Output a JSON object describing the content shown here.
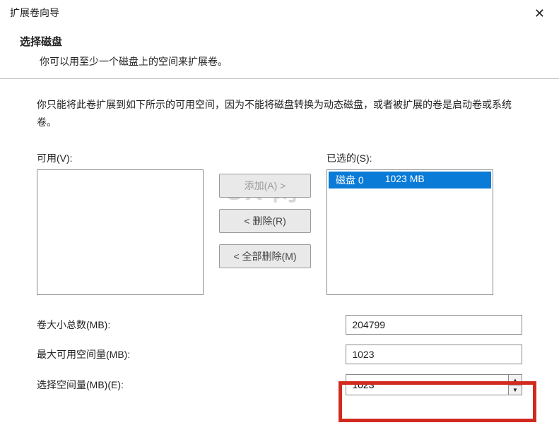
{
  "window": {
    "title": "扩展卷向导",
    "close_glyph": "✕"
  },
  "header": {
    "title": "选择磁盘",
    "subtitle": "你可以用至少一个磁盘上的空间来扩展卷。"
  },
  "description": "你只能将此卷扩展到如下所示的可用空间，因为不能将磁盘转换为动态磁盘，或者被扩展的卷是启动卷或系统卷。",
  "lists": {
    "available_label": "可用(V):",
    "selected_label": "已选的(S):",
    "available_items": [],
    "selected_items": [
      {
        "name": "磁盘 0",
        "size": "1023 MB"
      }
    ]
  },
  "buttons": {
    "add": "添加(A) >",
    "remove": "< 删除(R)",
    "remove_all": "< 全部删除(M)"
  },
  "fields": {
    "total_label": "卷大小总数(MB):",
    "total_value": "204799",
    "max_label": "最大可用空间量(MB):",
    "max_value": "1023",
    "select_label": "选择空间量(MB)(E):",
    "select_value": "1023"
  },
  "watermark": "GX 网"
}
